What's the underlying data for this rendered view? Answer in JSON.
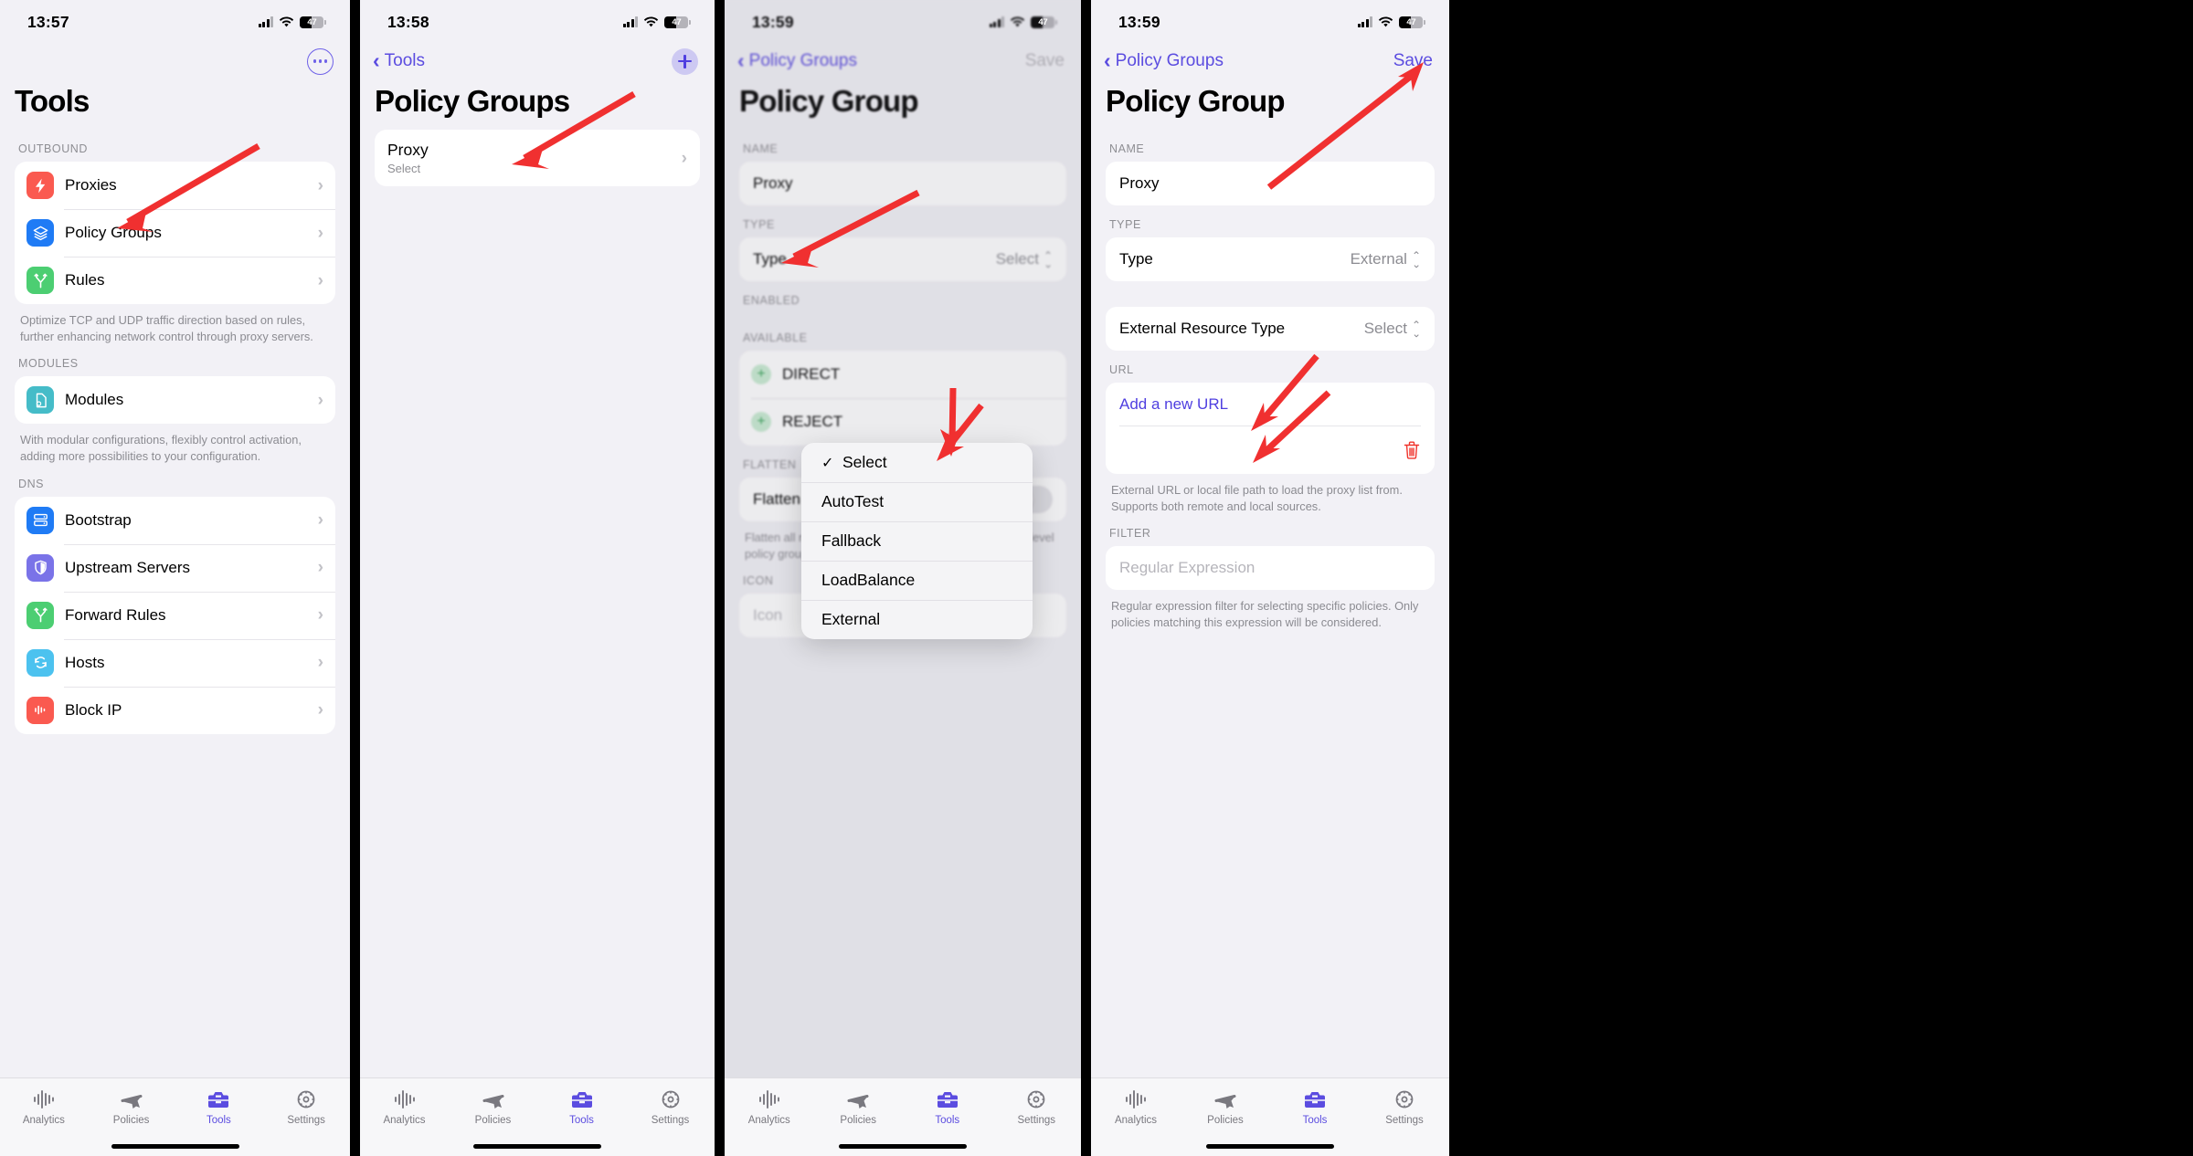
{
  "accent": "#5b4ce0",
  "annotation_color": "#f03030",
  "tabbar": {
    "tabs": [
      {
        "label": "Analytics",
        "icon": "waveform-icon",
        "active": false
      },
      {
        "label": "Policies",
        "icon": "airplane-icon",
        "active": false
      },
      {
        "label": "Tools",
        "icon": "toolbox-icon",
        "active": true
      },
      {
        "label": "Settings",
        "icon": "gear-icon",
        "active": false
      }
    ]
  },
  "panel1": {
    "status": {
      "time": "13:57",
      "battery": "47"
    },
    "more_button": "more-options",
    "title": "Tools",
    "sections": [
      {
        "header": "OUTBOUND",
        "items": [
          {
            "label": "Proxies",
            "icon": "bolt-icon",
            "color": "#fa5a50"
          },
          {
            "label": "Policy Groups",
            "icon": "layers-icon",
            "color": "#1f7bf5"
          },
          {
            "label": "Rules",
            "icon": "branch-icon",
            "color": "#4cce72"
          }
        ],
        "footnote": "Optimize TCP and UDP traffic direction based on rules, further enhancing network control through proxy servers."
      },
      {
        "header": "MODULES",
        "items": [
          {
            "label": "Modules",
            "icon": "document-gear-icon",
            "color": "#45bcc8"
          }
        ],
        "footnote": "With modular configurations, flexibly control activation, adding more possibilities to your configuration."
      },
      {
        "header": "DNS",
        "items": [
          {
            "label": "Bootstrap",
            "icon": "server-icon",
            "color": "#1f7bf5"
          },
          {
            "label": "Upstream Servers",
            "icon": "shield-icon",
            "color": "#7a73e8"
          },
          {
            "label": "Forward Rules",
            "icon": "branch-icon",
            "color": "#4cce72"
          },
          {
            "label": "Hosts",
            "icon": "refresh-icon",
            "color": "#4cc2ef"
          },
          {
            "label": "Block IP",
            "icon": "waveform-icon",
            "color": "#fa5a50"
          }
        ],
        "footnote": ""
      }
    ]
  },
  "panel2": {
    "status": {
      "time": "13:58",
      "battery": "47"
    },
    "back_label": "Tools",
    "add_button": "add-policy-group",
    "title": "Policy Groups",
    "rows": [
      {
        "title": "Proxy",
        "subtitle": "Select"
      }
    ]
  },
  "panel3": {
    "status": {
      "time": "13:59",
      "battery": "47"
    },
    "back_label": "Policy Groups",
    "save_label": "Save",
    "save_enabled": false,
    "title": "Policy Group",
    "name_header": "NAME",
    "name_value": "Proxy",
    "type_header": "TYPE",
    "type_label": "Type",
    "type_value": "Select",
    "enabled_header": "ENABLED",
    "available_header": "AVAILABLE",
    "available_items": [
      "DIRECT",
      "REJECT"
    ],
    "flatten_header": "FLATTEN",
    "flatten_label": "Flatten",
    "flatten_on": false,
    "flatten_footnote": "Flatten all nested policies in the policy group to the top-level policy group.",
    "icon_header": "ICON",
    "icon_placeholder": "Icon",
    "dropdown": {
      "options": [
        "Select",
        "AutoTest",
        "Fallback",
        "LoadBalance",
        "External"
      ],
      "selected": "Select"
    }
  },
  "panel4": {
    "status": {
      "time": "13:59",
      "battery": "47"
    },
    "back_label": "Policy Groups",
    "save_label": "Save",
    "save_enabled": true,
    "title": "Policy Group",
    "name_header": "NAME",
    "name_value": "Proxy",
    "type_header": "TYPE",
    "type_label": "Type",
    "type_value": "External",
    "resource_label": "External Resource Type",
    "resource_value": "Select",
    "url_header": "URL",
    "add_url_label": "Add a new URL",
    "url_footnote": "External URL or local file path to load the proxy list from. Supports both remote and local sources.",
    "filter_header": "FILTER",
    "filter_placeholder": "Regular Expression",
    "filter_footnote": "Regular expression filter for selecting specific policies. Only policies matching this expression will be considered."
  }
}
